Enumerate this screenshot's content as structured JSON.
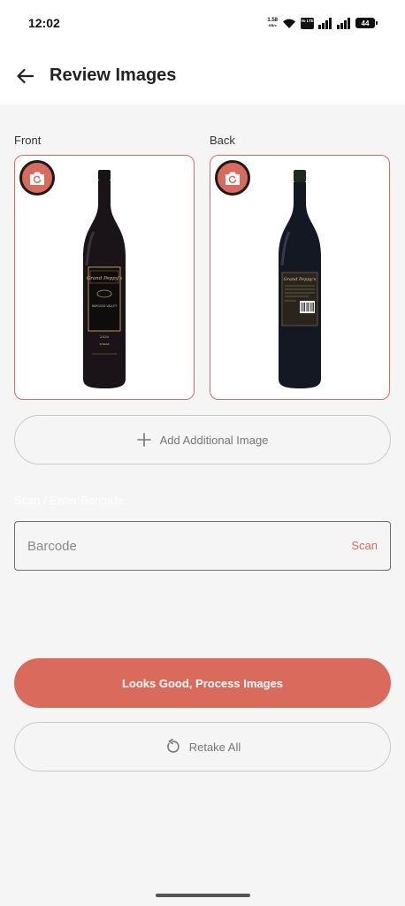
{
  "status_bar": {
    "time": "12:02",
    "net_speed_value": "1.58",
    "net_speed_unit": "KB/s",
    "sim1_label": "Vo LTE",
    "sim2_label": "Vo LTE",
    "battery": "44",
    "icons": [
      "wifi-icon",
      "signal-icon",
      "signal-icon",
      "battery-icon"
    ]
  },
  "header": {
    "title": "Review Images",
    "back_icon": "arrow-left-icon"
  },
  "images": {
    "front_label": "Front",
    "back_label": "Back",
    "retake_icon": "camera-retake-icon",
    "front_wine_name": "Grand Peppy's",
    "front_wine_region": "BAROSSA VALLEY",
    "front_wine_year": "2020",
    "front_wine_variety": "SHIRAZ",
    "back_wine_name": "Grand Peppy's"
  },
  "add_image": {
    "label": "Add Additional Image",
    "icon": "plus-icon"
  },
  "barcode": {
    "section_label": "Scan / Enter Barcode",
    "placeholder": "Barcode",
    "value": "",
    "scan_label": "Scan"
  },
  "actions": {
    "process_label": "Looks Good, Process Images",
    "retake_all_label": "Retake All",
    "retake_icon": "rotate-ccw-icon"
  },
  "colors": {
    "accent": "#d96a5c",
    "background": "#f5f5f5",
    "surface": "#ffffff"
  }
}
